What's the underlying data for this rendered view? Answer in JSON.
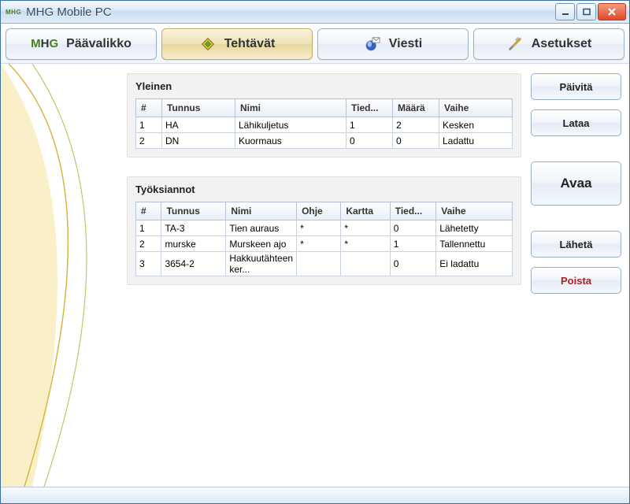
{
  "window": {
    "title": "MHG Mobile PC"
  },
  "toolbar": {
    "main_menu": "Päävalikko",
    "tasks": "Tehtävät",
    "message": "Viesti",
    "settings": "Asetukset"
  },
  "panels": {
    "general": {
      "title": "Yleinen",
      "columns": {
        "num": "#",
        "id": "Tunnus",
        "name": "Nimi",
        "files": "Tied...",
        "amount": "Määrä",
        "phase": "Vaihe"
      },
      "rows": [
        {
          "num": "1",
          "id": "HA",
          "name": "Lähikuljetus",
          "files": "1",
          "amount": "2",
          "phase": "Kesken"
        },
        {
          "num": "2",
          "id": "DN",
          "name": "Kuormaus",
          "files": "0",
          "amount": "0",
          "phase": "Ladattu"
        }
      ]
    },
    "assignments": {
      "title": "Työksiannot",
      "columns": {
        "num": "#",
        "id": "Tunnus",
        "name": "Nimi",
        "guide": "Ohje",
        "map": "Kartta",
        "files": "Tied...",
        "phase": "Vaihe"
      },
      "rows": [
        {
          "num": "1",
          "id": "TA-3",
          "name": "Tien auraus",
          "guide": "*",
          "map": "*",
          "files": "0",
          "phase": "Lähetetty"
        },
        {
          "num": "2",
          "id": "murske",
          "name": "Murskeen ajo",
          "guide": "*",
          "map": "*",
          "files": "1",
          "phase": "Tallennettu"
        },
        {
          "num": "3",
          "id": "3654-2",
          "name": "Hakkuutähteen ker...",
          "guide": "",
          "map": "",
          "files": "0",
          "phase": "Ei ladattu"
        }
      ]
    }
  },
  "actions": {
    "update": "Päivitä",
    "download": "Lataa",
    "open": "Avaa",
    "send": "Lähetä",
    "delete": "Poista"
  }
}
